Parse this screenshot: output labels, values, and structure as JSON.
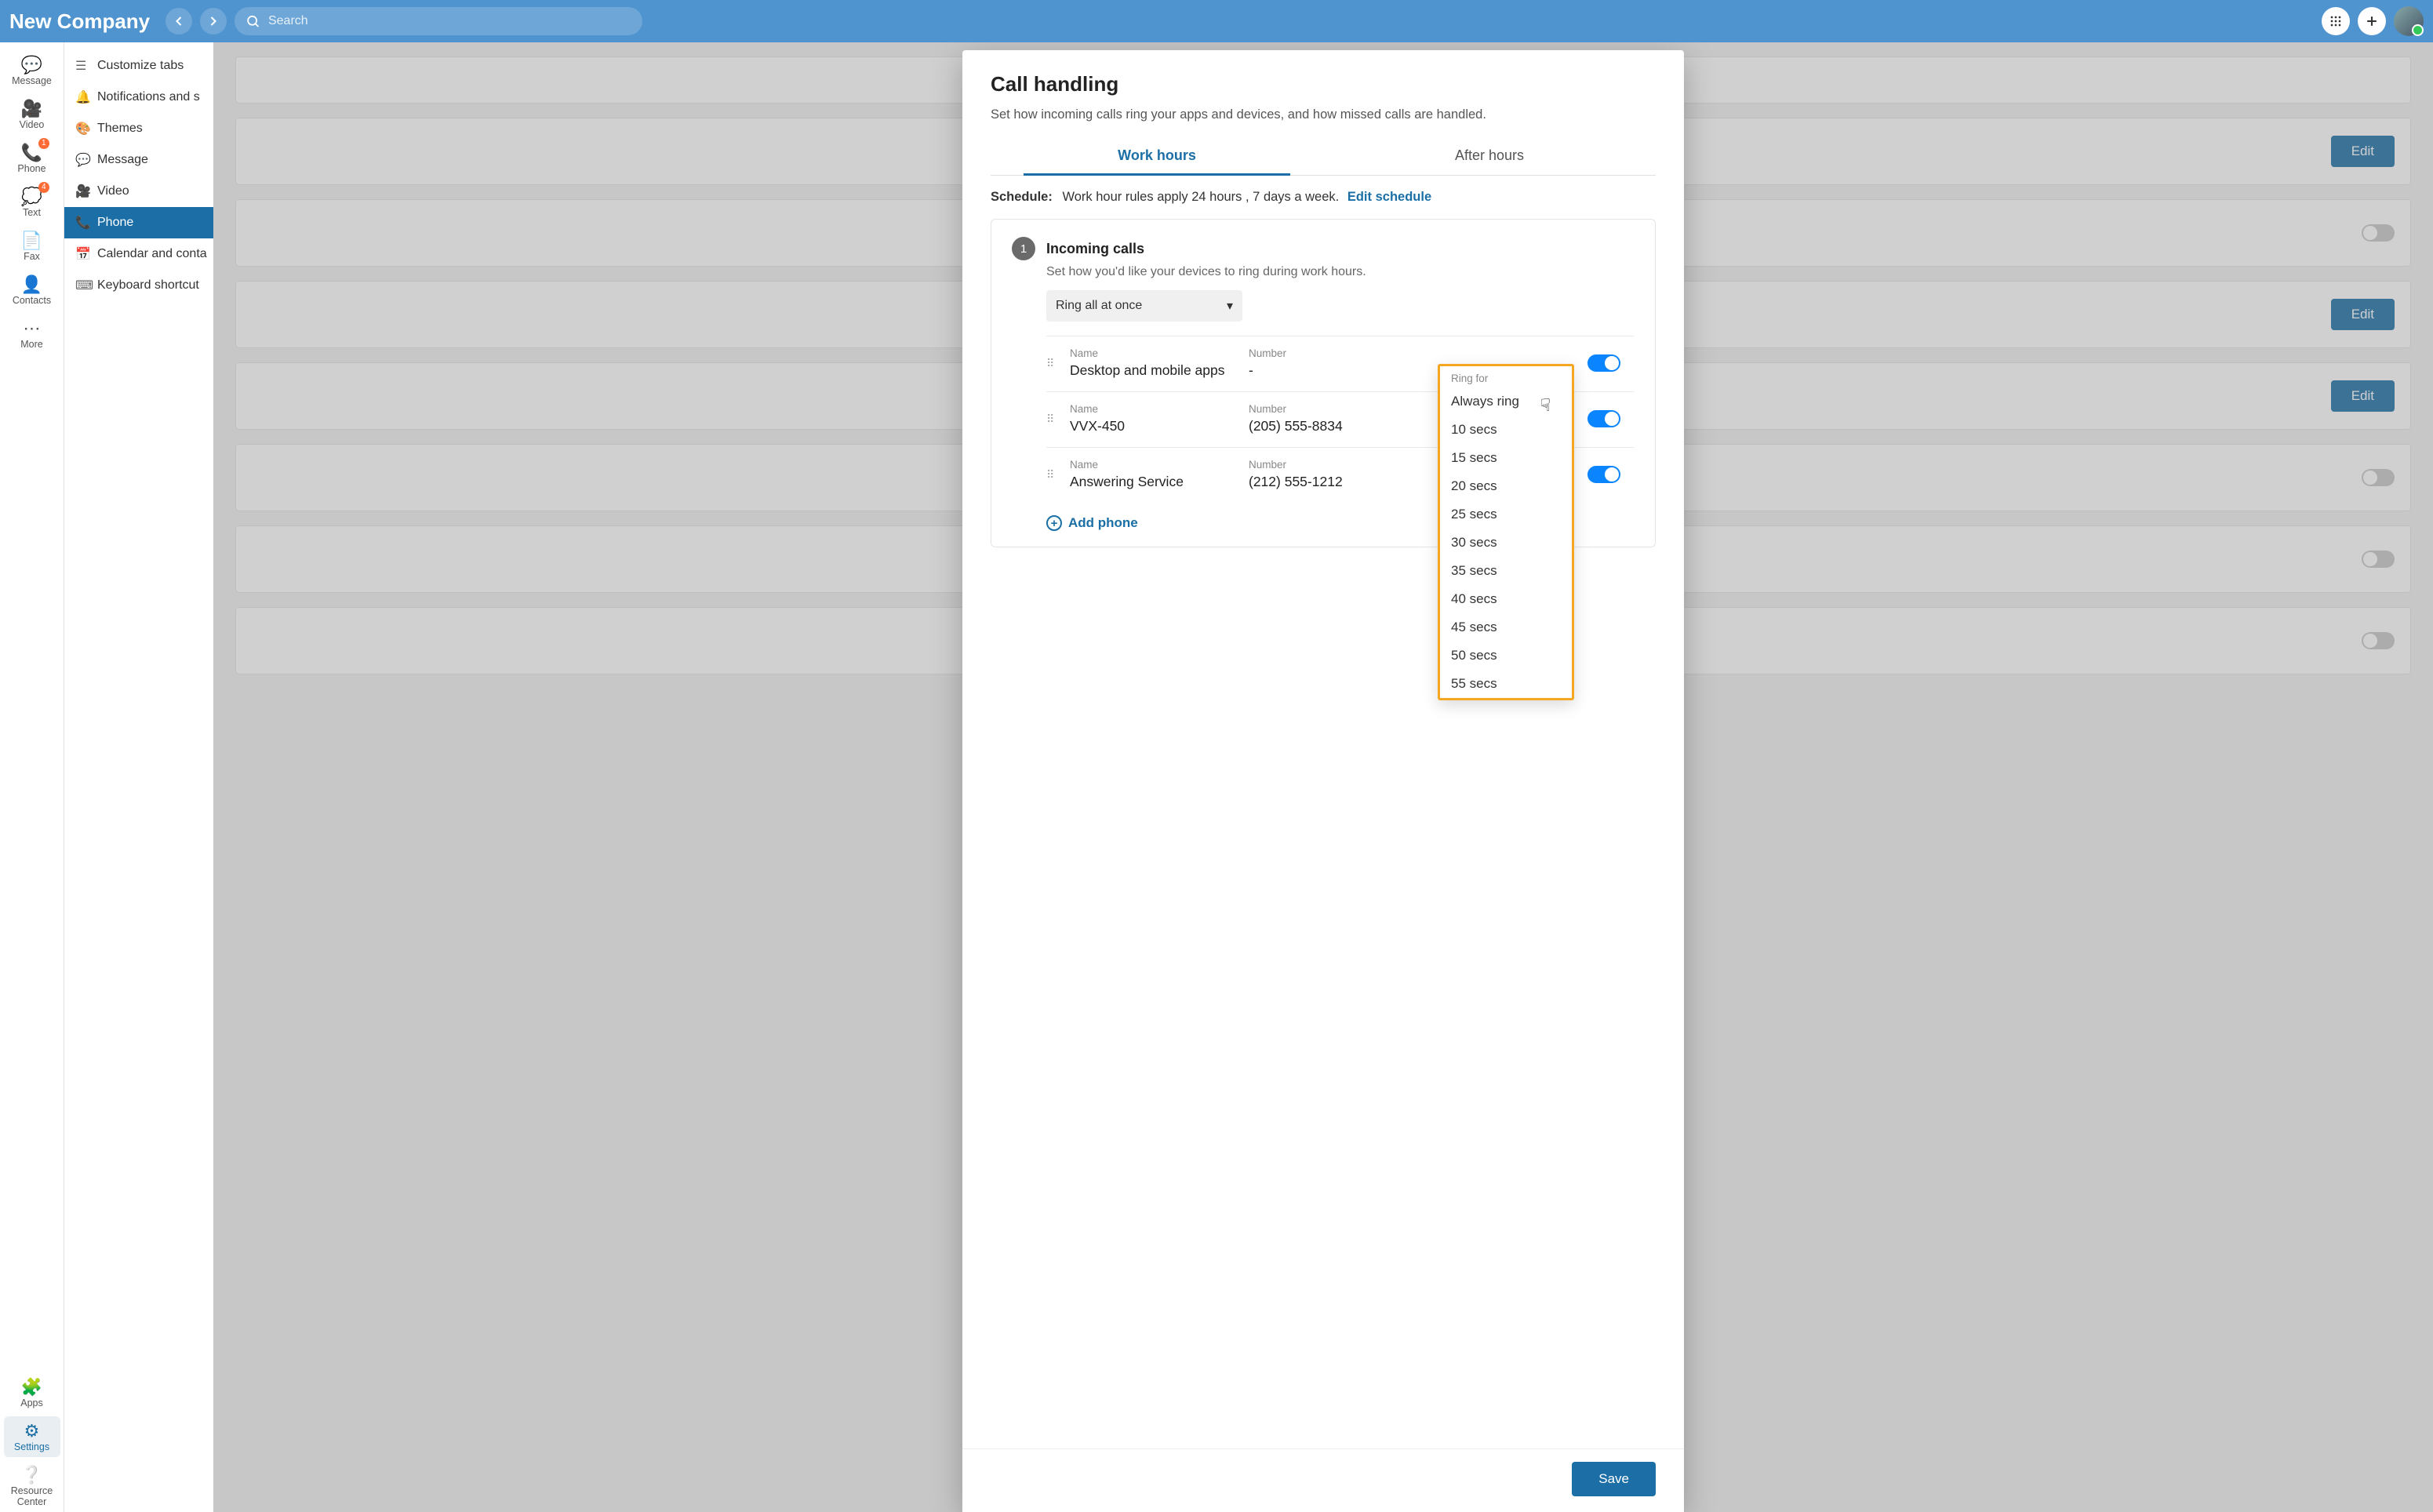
{
  "header": {
    "company": "New Company",
    "search_placeholder": "Search"
  },
  "leftnav": {
    "message": "Message",
    "video": "Video",
    "phone": "Phone",
    "phone_badge": "1",
    "text": "Text",
    "text_badge": "4",
    "fax": "Fax",
    "contacts": "Contacts",
    "more": "More",
    "apps": "Apps",
    "settings": "Settings",
    "resource": "Resource Center"
  },
  "settingsnav": {
    "customize": "Customize tabs",
    "notifications": "Notifications and s",
    "themes": "Themes",
    "message": "Message",
    "video": "Video",
    "phone": "Phone",
    "calendar": "Calendar and conta",
    "keyboard": "Keyboard shortcut"
  },
  "bg": {
    "edit": "Edit"
  },
  "modal": {
    "title": "Call handling",
    "subtitle": "Set how incoming calls ring your apps and devices, and how missed calls are handled.",
    "tab_work": "Work hours",
    "tab_after": "After hours",
    "schedule_label": "Schedule:",
    "schedule_text": "Work hour rules apply 24 hours , 7 days a week.",
    "schedule_link": "Edit schedule",
    "step1_num": "1",
    "step1_title": "Incoming calls",
    "step1_desc": "Set how you'd like your devices to ring during work hours.",
    "ring_mode": "Ring all at once",
    "col_name": "Name",
    "col_number": "Number",
    "col_ringfor": "Ring for",
    "devices": [
      {
        "name": "Desktop and mobile apps",
        "number": "-"
      },
      {
        "name": "VVX-450",
        "number": "(205) 555-8834"
      },
      {
        "name": "Answering Service",
        "number": "(212) 555-1212"
      }
    ],
    "add_phone": "Add phone",
    "save": "Save"
  },
  "ringfor": {
    "header": "Ring for",
    "options": [
      "Always ring",
      "10 secs",
      "15 secs",
      "20 secs",
      "25 secs",
      "30 secs",
      "35 secs",
      "40 secs",
      "45 secs",
      "50 secs",
      "55 secs"
    ]
  }
}
